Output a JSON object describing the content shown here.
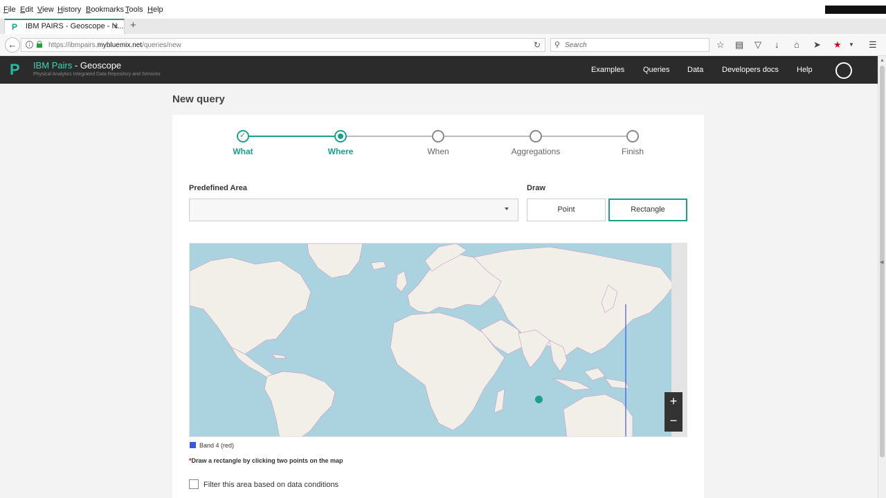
{
  "browser": {
    "menu": [
      "File",
      "Edit",
      "View",
      "History",
      "Bookmarks",
      "Tools",
      "Help"
    ],
    "tab": {
      "label": "IBM PAIRS - Geoscope - N...",
      "favicon": "P"
    },
    "url": {
      "prefix": "https://ibmpairs.",
      "domain": "mybluemix.net",
      "path": "/queries/new"
    },
    "search_placeholder": "Search",
    "icons": [
      "star-icon",
      "reader-icon",
      "pocket-icon",
      "download-icon",
      "home-icon",
      "send-icon",
      "bookmark-red-star-icon",
      "dropdown-icon",
      "hamburger-menu-icon"
    ]
  },
  "app": {
    "brand": "IBM Pairs",
    "title_suffix": " - Geoscope",
    "subtitle": "Physical Analytics Integrated Data Repository and Services",
    "nav": [
      "Examples",
      "Queries",
      "Data",
      "Developers docs",
      "Help"
    ]
  },
  "page": {
    "title": "New query",
    "steps": [
      {
        "label": "What",
        "state": "done"
      },
      {
        "label": "Where",
        "state": "active"
      },
      {
        "label": "When",
        "state": "todo"
      },
      {
        "label": "Aggregations",
        "state": "todo"
      },
      {
        "label": "Finish",
        "state": "todo"
      }
    ],
    "predefined_area": {
      "label": "Predefined Area",
      "value": ""
    },
    "draw": {
      "label": "Draw",
      "options": [
        "Point",
        "Rectangle"
      ],
      "selected": "Rectangle"
    },
    "map": {
      "zoom_in": "+",
      "zoom_out": "−",
      "colors": {
        "water": "#aad3df",
        "land": "#f2efe9",
        "border": "#c7a7c7",
        "line": "#3a5bd9"
      }
    },
    "legend": {
      "label": "Band 4 (red)",
      "color": "#3a5bd9"
    },
    "hint": {
      "asterisk": "*",
      "text": "Draw a rectangle by clicking two points on the map"
    },
    "filter": {
      "label": "Filter this area based on data conditions",
      "checked": false
    }
  },
  "colors": {
    "accent": "#1aa08a",
    "header_bg": "#2b2b2b"
  }
}
